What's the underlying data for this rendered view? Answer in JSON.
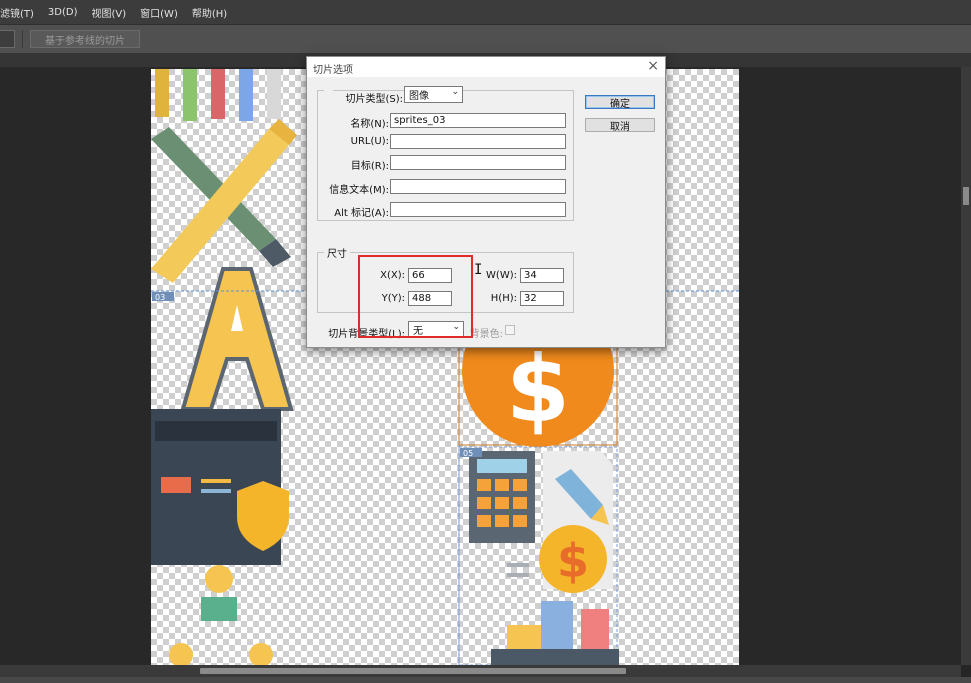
{
  "menubar": {
    "items": [
      "滤镜(T)",
      "3D(D)",
      "视图(V)",
      "窗口(W)",
      "帮助(H)"
    ]
  },
  "options_bar": {
    "slices_from_guides_label": "基于参考线的切片"
  },
  "canvas": {
    "slice_badges": [
      "03",
      "05"
    ]
  },
  "dialog": {
    "title": "切片选项",
    "slice_type_label": "切片类型(S):",
    "slice_type_value": "图像",
    "name_label": "名称(N):",
    "name_value": "sprites_03",
    "url_label": "URL(U):",
    "url_value": "",
    "target_label": "目标(R):",
    "target_value": "",
    "message_label": "信息文本(M):",
    "message_value": "",
    "alt_label": "Alt 标记(A):",
    "alt_value": "",
    "ok_label": "确定",
    "cancel_label": "取消",
    "dimensions": {
      "group_label": "尺寸",
      "x_label": "X(X):",
      "x_value": "66",
      "y_label": "Y(Y):",
      "y_value": "488",
      "w_label": "W(W):",
      "w_value": "34",
      "h_label": "H(H):",
      "h_value": "32"
    },
    "bg_type_label": "切片背景类型(L):",
    "bg_type_value": "无",
    "bg_color_label": "背景色:"
  },
  "colors": {
    "highlight_box": "#e02b2b",
    "canvas_bg": "#282828",
    "dialog_bg": "#f0f0f0"
  }
}
